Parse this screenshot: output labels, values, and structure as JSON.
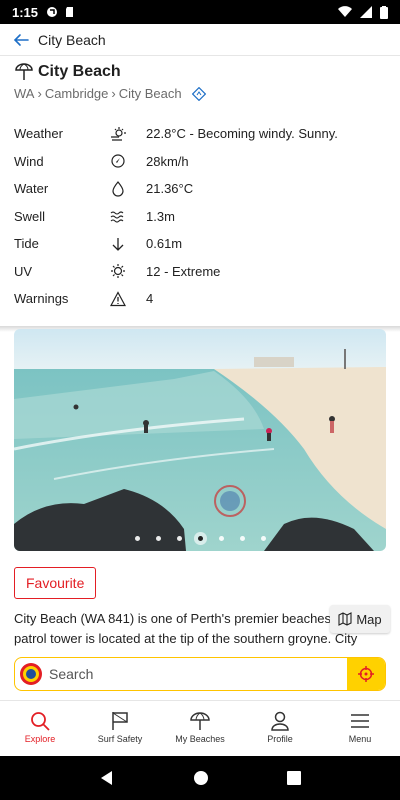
{
  "status_bar": {
    "time": "1:15"
  },
  "app_bar": {
    "title": "City Beach"
  },
  "beach": {
    "name": "City Beach",
    "breadcrumb": [
      "WA",
      "Cambridge",
      "City Beach"
    ]
  },
  "conditions": [
    {
      "label": "Weather",
      "icon": "sun-wind-icon",
      "value": "22.8°C - Becoming windy. Sunny."
    },
    {
      "label": "Wind",
      "icon": "wind-direction-icon",
      "value": "28km/h"
    },
    {
      "label": "Water",
      "icon": "water-drop-icon",
      "value": "21.36°C"
    },
    {
      "label": "Swell",
      "icon": "swell-waves-icon",
      "value": "1.3m"
    },
    {
      "label": "Tide",
      "icon": "tide-arrow-down-icon",
      "value": "0.61m"
    },
    {
      "label": "UV",
      "icon": "uv-sun-icon",
      "value": "12 - Extreme"
    },
    {
      "label": "Warnings",
      "icon": "warning-triangle-icon",
      "value": "4"
    }
  ],
  "gallery": {
    "image_count": 7,
    "active_index": 3
  },
  "favourite": {
    "label": "Favourite"
  },
  "description": "City Beach (WA 841) is one of Perth's premier beaches. City patrol tower is located at the tip of the southern groyne. City",
  "map_button": {
    "label": "Map"
  },
  "search": {
    "placeholder": "Search"
  },
  "bottom_nav": [
    {
      "label": "Explore",
      "icon": "search-icon",
      "active": true
    },
    {
      "label": "Surf Safety",
      "icon": "flag-icon",
      "active": false
    },
    {
      "label": "My Beaches",
      "icon": "beach-umbrella-icon",
      "active": false
    },
    {
      "label": "Profile",
      "icon": "person-icon",
      "active": false
    },
    {
      "label": "Menu",
      "icon": "menu-icon",
      "active": false
    }
  ],
  "colors": {
    "accent": "#e31e24",
    "search_accent": "#ffd100"
  }
}
